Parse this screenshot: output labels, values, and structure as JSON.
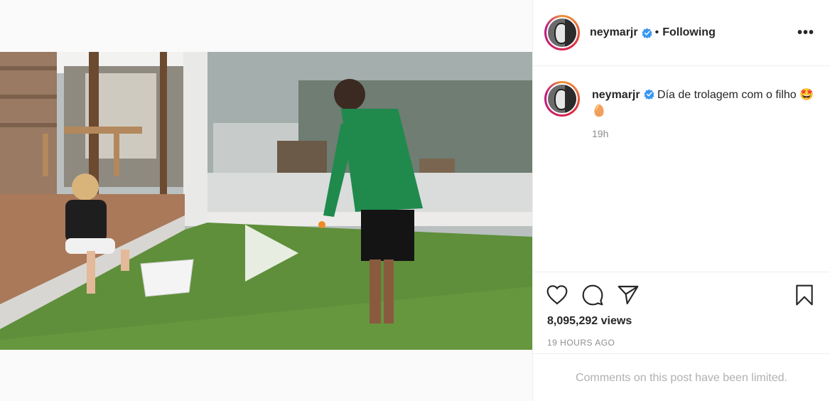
{
  "post": {
    "username": "neymarjr",
    "follow_status": "Following",
    "separator": "•",
    "more_label": "•••",
    "caption_text": "Día de trolagem com o filho 🤩🥚",
    "caption_time": "19h",
    "views": "8,095,292 views",
    "time_ago": "19 HOURS AGO",
    "comments_notice": "Comments on this post have been limited."
  },
  "icons": {
    "verified": "verified-badge-icon",
    "like": "heart-icon",
    "comment": "comment-bubble-icon",
    "share": "paper-plane-icon",
    "save": "bookmark-icon",
    "play": "play-icon"
  },
  "colors": {
    "verified_blue": "#3897f0",
    "text": "#262626",
    "muted": "#8e8e8e"
  }
}
